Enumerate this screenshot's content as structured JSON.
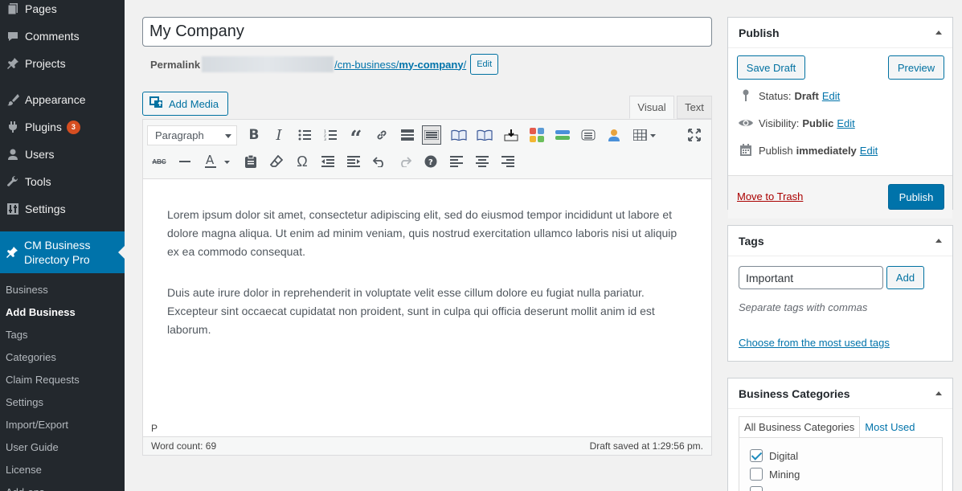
{
  "sidebar": {
    "items": [
      {
        "label": "Pages",
        "icon": "pages-icon"
      },
      {
        "label": "Comments",
        "icon": "comments-icon"
      },
      {
        "label": "Projects",
        "icon": "pin-icon"
      },
      {
        "label": "Appearance",
        "icon": "brush-icon"
      },
      {
        "label": "Plugins",
        "icon": "plugin-icon",
        "badge": "3"
      },
      {
        "label": "Users",
        "icon": "user-icon"
      },
      {
        "label": "Tools",
        "icon": "wrench-icon"
      },
      {
        "label": "Settings",
        "icon": "settings-icon"
      }
    ],
    "current": {
      "line1": "CM Business",
      "line2": "Directory Pro",
      "icon": "pin-icon"
    },
    "submenu": [
      "Business",
      "Add Business",
      "Tags",
      "Categories",
      "Claim Requests",
      "Settings",
      "Import/Export",
      "User Guide",
      "License",
      "Add-ons"
    ]
  },
  "editor": {
    "title": "My Company",
    "permalink_label": "Permalink",
    "permalink_path": "/cm-business/",
    "permalink_slug": "my-company",
    "permalink_end": "/",
    "edit_label": "Edit",
    "add_media": "Add Media",
    "tab_visual": "Visual",
    "tab_text": "Text",
    "format": "Paragraph",
    "paragraphs": [
      "Lorem ipsum dolor sit amet, consectetur adipiscing elit, sed do eiusmod tempor incididunt ut labore et dolore magna aliqua. Ut enim ad minim veniam, quis nostrud exercitation ullamco laboris nisi ut aliquip ex ea commodo consequat.",
      "Duis aute irure dolor in reprehenderit in voluptate velit esse cillum dolore eu fugiat nulla pariatur. Excepteur sint occaecat cupidatat non proident, sunt in culpa qui officia deserunt mollit anim id est laborum."
    ],
    "path": "P",
    "word_count": "Word count: 69",
    "draft_saved": "Draft saved at 1:29:56 pm."
  },
  "publish": {
    "title": "Publish",
    "save_draft": "Save Draft",
    "preview": "Preview",
    "status_label": "Status:",
    "status_value": "Draft",
    "visibility_label": "Visibility:",
    "visibility_value": "Public",
    "schedule_label": "Publish",
    "schedule_value": "immediately",
    "edit": "Edit",
    "trash": "Move to Trash",
    "publish_button": "Publish"
  },
  "tags": {
    "title": "Tags",
    "input_value": "Important",
    "add": "Add",
    "hint": "Separate tags with commas",
    "choose": "Choose from the most used tags"
  },
  "categories": {
    "title": "Business Categories",
    "tab_all": "All Business Categories",
    "tab_used": "Most Used",
    "items": [
      {
        "label": "Digital",
        "checked": true
      },
      {
        "label": "Mining",
        "checked": false
      }
    ]
  },
  "colors": {
    "accent": "#0073aa",
    "sidebar": "#23282d",
    "badge": "#d54e21",
    "trash": "#aa0000"
  }
}
